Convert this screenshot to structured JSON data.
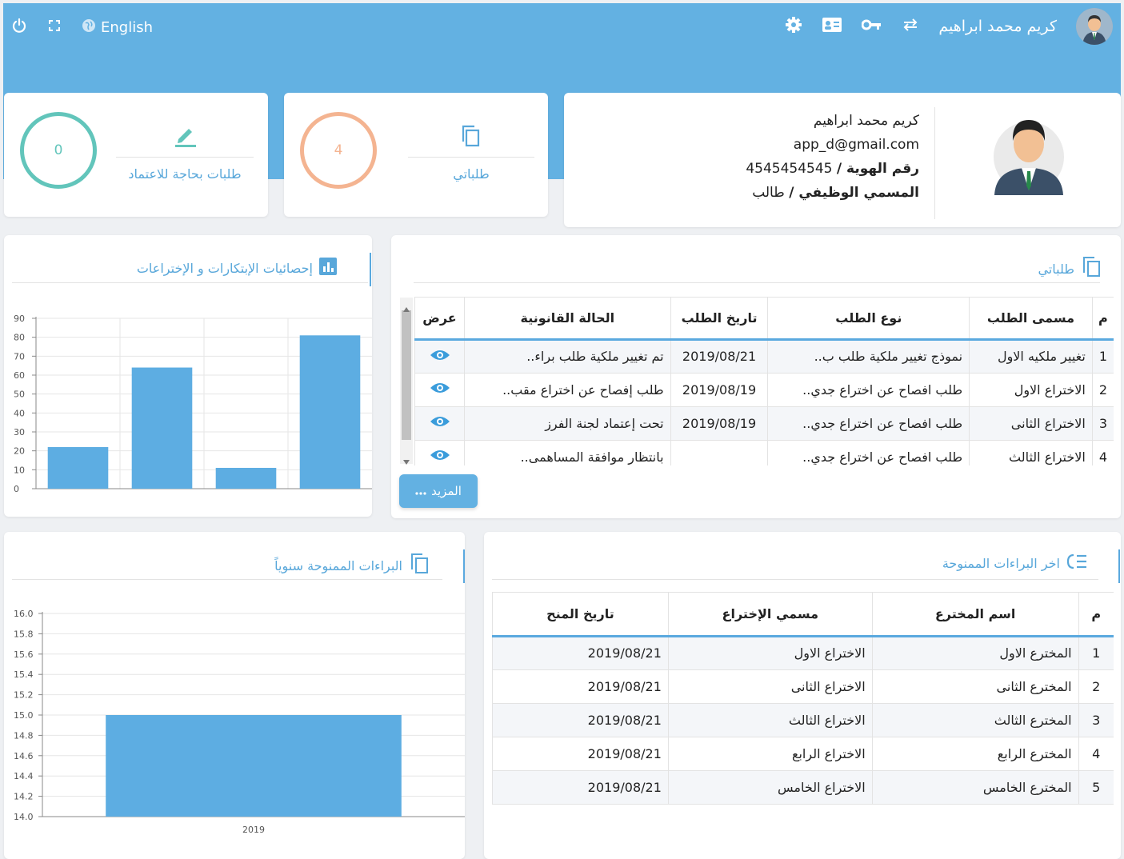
{
  "nav": {
    "language": "English",
    "user_name": "كريم محمد ابراهيم"
  },
  "stats": {
    "pending": {
      "value": "0",
      "label": "طلبات بحاجة للاعتماد",
      "color": "#62c5bb"
    },
    "mine": {
      "value": "4",
      "label": "طلباتي",
      "color": "#f4b491"
    }
  },
  "profile": {
    "name": "كريم محمد ابراهيم",
    "email": "app_d@gmail.com",
    "id_label": "رقم الهوية /",
    "id_value": "4545454545",
    "job_label": "المسمي الوظيفي /",
    "job_value": "طالب"
  },
  "requests": {
    "title": "طلباتي",
    "columns": [
      "م",
      "مسمى الطلب",
      "نوع الطلب",
      "تاريخ الطلب",
      "الحالة القانونية",
      "عرض"
    ],
    "rows": [
      {
        "n": "1",
        "name": "تغيير ملكيه الاول",
        "type": "نموذج تغيير ملكية طلب ب..",
        "date": "2019/08/21",
        "status": "تم تغيير ملكية طلب براء.."
      },
      {
        "n": "2",
        "name": "الاختراع الاول",
        "type": "طلب افصاح عن اختراع جدي..",
        "date": "2019/08/19",
        "status": "طلب إفصاح عن اختراع مقب.."
      },
      {
        "n": "3",
        "name": "الاختراع الثانى",
        "type": "طلب افصاح عن اختراع جدي..",
        "date": "2019/08/19",
        "status": "تحت إعتماد لجنة الفرز"
      },
      {
        "n": "4",
        "name": "الاختراع الثالث",
        "type": "طلب افصاح عن اختراع جدي..",
        "date": "",
        "status": "بانتظار موافقة المساهمى.."
      }
    ],
    "more_label": "المزيد"
  },
  "inventions_stats": {
    "title": "إحصائيات الإبتكارات و الإختراعات"
  },
  "patents_latest": {
    "title": "اخر البراءات الممنوحة",
    "columns": [
      "م",
      "اسم المخترع",
      "مسمي الإختراع",
      "تاريخ المنح"
    ],
    "rows": [
      {
        "n": "1",
        "inventor": "المخترع الاول",
        "invention": "الاختراع الاول",
        "date": "2019/08/21"
      },
      {
        "n": "2",
        "inventor": "المخترع الثانى",
        "invention": "الاختراع الثانى",
        "date": "2019/08/21"
      },
      {
        "n": "3",
        "inventor": "المخترع الثالث",
        "invention": "الاختراع الثالث",
        "date": "2019/08/21"
      },
      {
        "n": "4",
        "inventor": "المخترع الرابع",
        "invention": "الاختراع الرابع",
        "date": "2019/08/21"
      },
      {
        "n": "5",
        "inventor": "المخترع الخامس",
        "invention": "الاختراع الخامس",
        "date": "2019/08/21"
      }
    ]
  },
  "patents_yearly": {
    "title": "البراءات الممنوحة سنوياً"
  },
  "chart_data": [
    {
      "type": "bar",
      "title": "إحصائيات الإبتكارات و الإختراعات",
      "categories": [
        "",
        "",
        "",
        ""
      ],
      "values": [
        22,
        64,
        11,
        81
      ],
      "ylim": [
        0,
        90
      ],
      "yticks": [
        "0",
        "10",
        "20",
        "30",
        "40",
        "50",
        "60",
        "70",
        "80",
        "90"
      ],
      "color": "#5dade2",
      "grid": true
    },
    {
      "type": "bar",
      "title": "البراءات الممنوحة سنوياً",
      "categories": [
        "2019"
      ],
      "values": [
        15
      ],
      "ylim": [
        14.0,
        16.0
      ],
      "yticks": [
        "14.0",
        "14.2",
        "14.4",
        "14.6",
        "14.8",
        "15.0",
        "15.2",
        "15.4",
        "15.6",
        "15.8",
        "16.0"
      ],
      "color": "#5dade2",
      "grid": true
    }
  ]
}
